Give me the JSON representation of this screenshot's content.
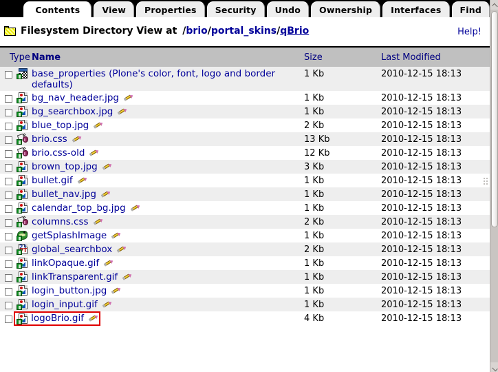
{
  "tabs": [
    {
      "label": "Contents",
      "active": true
    },
    {
      "label": "View",
      "active": false
    },
    {
      "label": "Properties",
      "active": false
    },
    {
      "label": "Security",
      "active": false
    },
    {
      "label": "Undo",
      "active": false
    },
    {
      "label": "Ownership",
      "active": false
    },
    {
      "label": "Interfaces",
      "active": false
    },
    {
      "label": "Find",
      "active": false
    }
  ],
  "header": {
    "icon": "folder-icon",
    "title": "Filesystem Directory View at",
    "path_segments": [
      {
        "sep": "/",
        "label": "brio",
        "leaf": false
      },
      {
        "sep": "/",
        "label": "portal_skins",
        "leaf": false
      },
      {
        "sep": "/",
        "label": "qBrio",
        "leaf": true
      }
    ],
    "help_label": "Help!"
  },
  "table": {
    "columns": [
      "Type",
      "Name",
      "Size",
      "Last Modified"
    ],
    "rows": [
      {
        "name": "base_properties (Plone's color, font, logo and border defaults)",
        "icon": "props-icon",
        "size": "1 Kb",
        "modified": "2010-12-15 18:13",
        "pencil": false,
        "checked": false,
        "highlighted": false
      },
      {
        "name": "bg_nav_header.jpg",
        "icon": "image-icon",
        "size": "1 Kb",
        "modified": "2010-12-15 18:13",
        "pencil": true,
        "checked": false,
        "highlighted": false
      },
      {
        "name": "bg_searchbox.jpg",
        "icon": "image-icon",
        "size": "1 Kb",
        "modified": "2010-12-15 18:13",
        "pencil": true,
        "checked": false,
        "highlighted": false
      },
      {
        "name": "blue_top.jpg",
        "icon": "image-icon",
        "size": "2 Kb",
        "modified": "2010-12-15 18:13",
        "pencil": true,
        "checked": false,
        "highlighted": false
      },
      {
        "name": "brio.css",
        "icon": "css-icon",
        "size": "13 Kb",
        "modified": "2010-12-15 18:13",
        "pencil": true,
        "checked": false,
        "highlighted": false
      },
      {
        "name": "brio.css-old",
        "icon": "css-icon",
        "size": "12 Kb",
        "modified": "2010-12-15 18:13",
        "pencil": true,
        "checked": false,
        "highlighted": false
      },
      {
        "name": "brown_top.jpg",
        "icon": "image-icon",
        "size": "3 Kb",
        "modified": "2010-12-15 18:13",
        "pencil": true,
        "checked": false,
        "highlighted": false
      },
      {
        "name": "bullet.gif",
        "icon": "image-icon",
        "size": "1 Kb",
        "modified": "2010-12-15 18:13",
        "pencil": true,
        "checked": false,
        "highlighted": false
      },
      {
        "name": "bullet_nav.jpg",
        "icon": "image-icon",
        "size": "1 Kb",
        "modified": "2010-12-15 18:13",
        "pencil": true,
        "checked": false,
        "highlighted": false
      },
      {
        "name": "calendar_top_bg.jpg",
        "icon": "image-icon",
        "size": "1 Kb",
        "modified": "2010-12-15 18:13",
        "pencil": true,
        "checked": false,
        "highlighted": false
      },
      {
        "name": "columns.css",
        "icon": "css-icon",
        "size": "2 Kb",
        "modified": "2010-12-15 18:13",
        "pencil": true,
        "checked": false,
        "highlighted": false
      },
      {
        "name": "getSplashImage",
        "icon": "script-icon",
        "size": "1 Kb",
        "modified": "2010-12-15 18:13",
        "pencil": true,
        "checked": false,
        "highlighted": false
      },
      {
        "name": "global_searchbox",
        "icon": "template-icon",
        "size": "2 Kb",
        "modified": "2010-12-15 18:13",
        "pencil": true,
        "checked": false,
        "highlighted": false
      },
      {
        "name": "linkOpaque.gif",
        "icon": "image-icon",
        "size": "1 Kb",
        "modified": "2010-12-15 18:13",
        "pencil": true,
        "checked": false,
        "highlighted": false
      },
      {
        "name": "linkTransparent.gif",
        "icon": "image-icon",
        "size": "1 Kb",
        "modified": "2010-12-15 18:13",
        "pencil": true,
        "checked": false,
        "highlighted": false
      },
      {
        "name": "login_button.jpg",
        "icon": "image-icon",
        "size": "1 Kb",
        "modified": "2010-12-15 18:13",
        "pencil": true,
        "checked": false,
        "highlighted": false
      },
      {
        "name": "login_input.gif",
        "icon": "image-icon",
        "size": "1 Kb",
        "modified": "2010-12-15 18:13",
        "pencil": true,
        "checked": false,
        "highlighted": false
      },
      {
        "name": "logoBrio.gif",
        "icon": "image-icon",
        "size": "4 Kb",
        "modified": "2010-12-15 18:13",
        "pencil": true,
        "checked": false,
        "highlighted": true
      }
    ]
  },
  "scrollbar": {
    "orientation": "vertical",
    "up_icon": "chevron-up-icon",
    "down_icon": "chevron-down-icon"
  },
  "colors": {
    "link": "#000099",
    "header_bg": "#c0c0c0",
    "tab_active": "#ffffff",
    "tab_inactive": "#eeeeee",
    "row_alt": "#eeeeee",
    "highlight": "#e00000"
  }
}
